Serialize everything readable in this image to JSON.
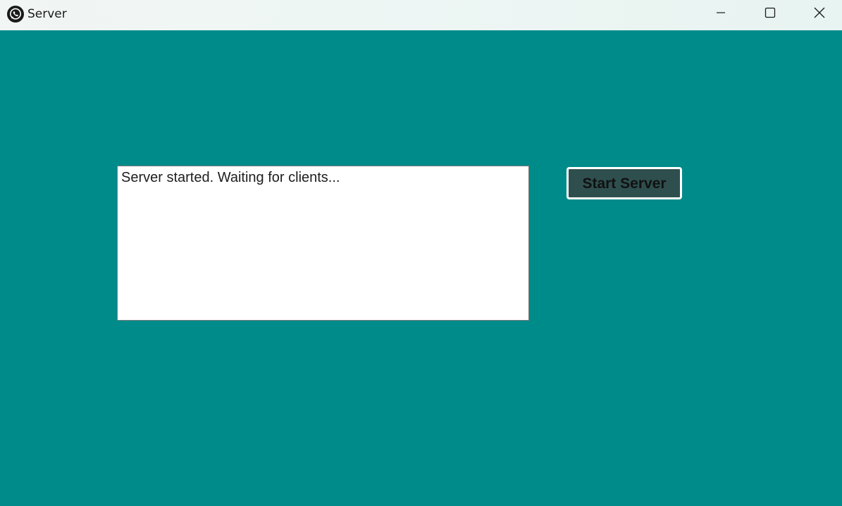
{
  "window": {
    "title": "Server",
    "icon": "whatsapp-icon",
    "controls": {
      "minimize": "minimize-icon",
      "maximize": "maximize-icon",
      "close": "close-icon"
    }
  },
  "main": {
    "log_text": "Server started. Waiting for clients...",
    "start_button_label": "Start Server"
  },
  "colors": {
    "background": "#008b8b",
    "button_bg": "#2f4f4f",
    "button_border": "#ffffff",
    "log_bg": "#ffffff"
  }
}
